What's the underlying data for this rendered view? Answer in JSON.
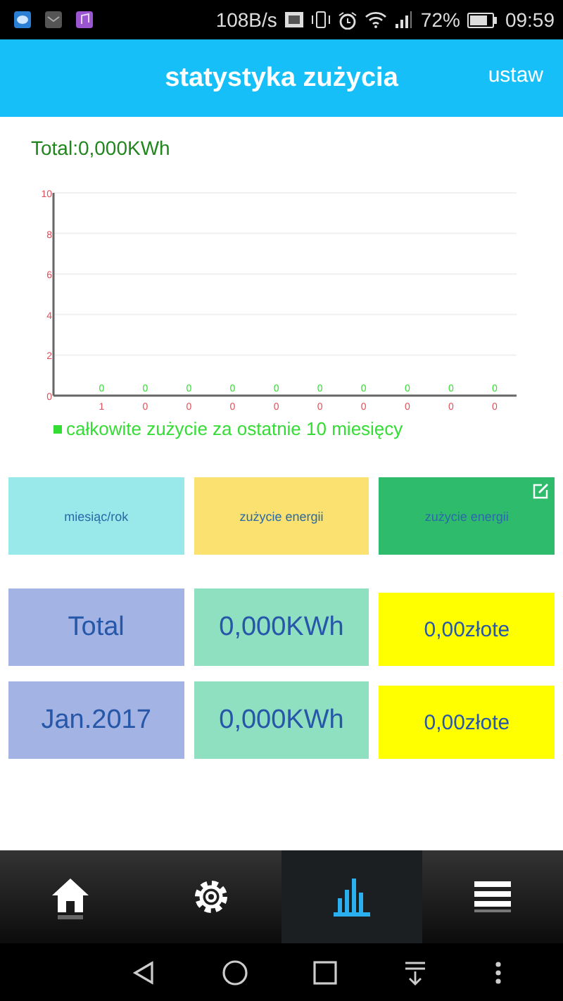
{
  "status_bar": {
    "speed": "108B/s",
    "battery": "72%",
    "time": "09:59"
  },
  "header": {
    "title": "statystyka zużycia",
    "action": "ustaw"
  },
  "total": "Total:0,000KWh",
  "chart": {
    "chart_data": {
      "type": "bar",
      "categories": [
        "1",
        "0",
        "0",
        "0",
        "0",
        "0",
        "0",
        "0",
        "0",
        "0"
      ],
      "series": [
        {
          "name": "całkowite zużycie za ostatnie 10 miesięcy",
          "color": "#33dd33",
          "values": [
            0,
            0,
            0,
            0,
            0,
            0,
            0,
            0,
            0,
            0
          ]
        }
      ],
      "ylim": [
        0,
        10
      ],
      "grid": true,
      "yticks": [
        0,
        2,
        4,
        6,
        8,
        10
      ],
      "data_labels": true
    }
  },
  "table": {
    "header": [
      {
        "label": "miesiąc/rok",
        "color": "#99e8ea"
      },
      {
        "label": "zużycie energii",
        "color": "#fae170"
      },
      {
        "label": "zużycie energii",
        "color": "#2ebc6c",
        "editable": true
      }
    ],
    "rows": [
      [
        "Total",
        "0,000KWh",
        "0,00złote"
      ],
      [
        "Jan.2017",
        "0,000KWh",
        "0,00złote"
      ]
    ]
  },
  "tabs": [
    {
      "kind": "home",
      "selected": false
    },
    {
      "kind": "settings",
      "selected": false
    },
    {
      "kind": "stats",
      "selected": true
    },
    {
      "kind": "menu",
      "selected": false
    }
  ]
}
